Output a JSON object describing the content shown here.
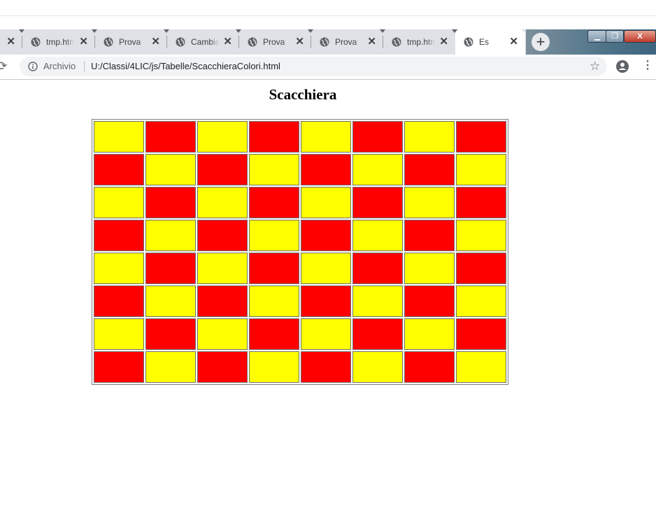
{
  "browser": {
    "tabs": [
      {
        "title": "",
        "active": false
      },
      {
        "title": "tmp.htm",
        "active": false
      },
      {
        "title": "Prova",
        "active": false
      },
      {
        "title": "Cambia",
        "active": false
      },
      {
        "title": "Prova",
        "active": false
      },
      {
        "title": "Prova",
        "active": false
      },
      {
        "title": "tmp.htm",
        "active": false
      },
      {
        "title": "Es",
        "active": true
      }
    ],
    "tab_close_glyph": "✕",
    "new_tab_glyph": "+",
    "address": {
      "security_label": "Archivio",
      "url": "U:/Classi/4LIC/js/Tabelle/ScacchieraColori.html"
    },
    "icons": {
      "reload": "reload-icon",
      "info": "info-icon",
      "bookmark": "star-icon",
      "account": "account-icon",
      "menu": "menu-icon",
      "tab_favicon": "globe-icon"
    }
  },
  "page": {
    "heading": "Scacchiera",
    "board": {
      "rows": 8,
      "cols": 8,
      "colors": {
        "yellow": "#ffff00",
        "red": "#ff0000"
      },
      "cells": [
        [
          "yellow",
          "red",
          "yellow",
          "red",
          "yellow",
          "red",
          "yellow",
          "red"
        ],
        [
          "red",
          "yellow",
          "red",
          "yellow",
          "red",
          "yellow",
          "red",
          "yellow"
        ],
        [
          "yellow",
          "red",
          "yellow",
          "red",
          "yellow",
          "red",
          "yellow",
          "red"
        ],
        [
          "red",
          "yellow",
          "red",
          "yellow",
          "red",
          "yellow",
          "red",
          "yellow"
        ],
        [
          "yellow",
          "red",
          "yellow",
          "red",
          "yellow",
          "red",
          "yellow",
          "red"
        ],
        [
          "red",
          "yellow",
          "red",
          "yellow",
          "red",
          "yellow",
          "red",
          "yellow"
        ],
        [
          "yellow",
          "red",
          "yellow",
          "red",
          "yellow",
          "red",
          "yellow",
          "red"
        ],
        [
          "red",
          "yellow",
          "red",
          "yellow",
          "red",
          "yellow",
          "red",
          "yellow"
        ]
      ]
    }
  }
}
